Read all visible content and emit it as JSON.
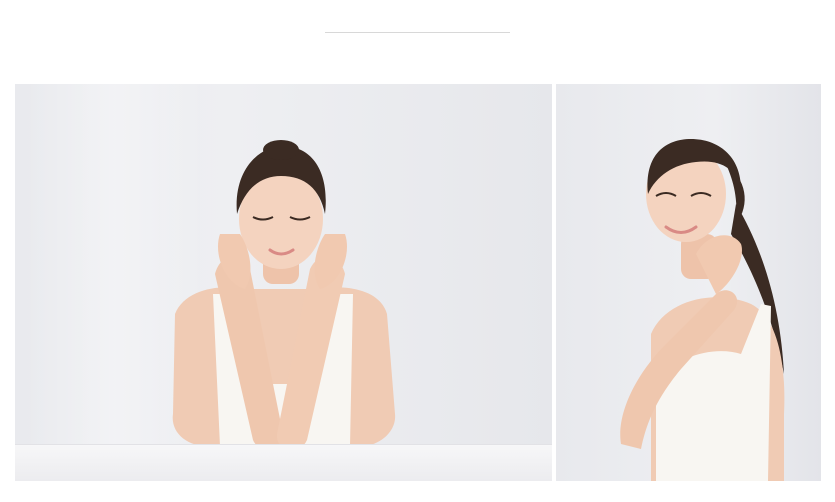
{
  "page": {
    "title": ""
  },
  "gallery": {
    "photos": [
      {
        "name": "portrait-eyes-closed",
        "alt": ""
      },
      {
        "name": "portrait-smiling-side",
        "alt": ""
      }
    ]
  },
  "colors": {
    "background": "#ffffff",
    "backdrop": "#eceef1",
    "skin": "#f2cdb6",
    "hair": "#3a2a22",
    "top": "#f7f5f2",
    "divider": "#d8d8d8"
  }
}
